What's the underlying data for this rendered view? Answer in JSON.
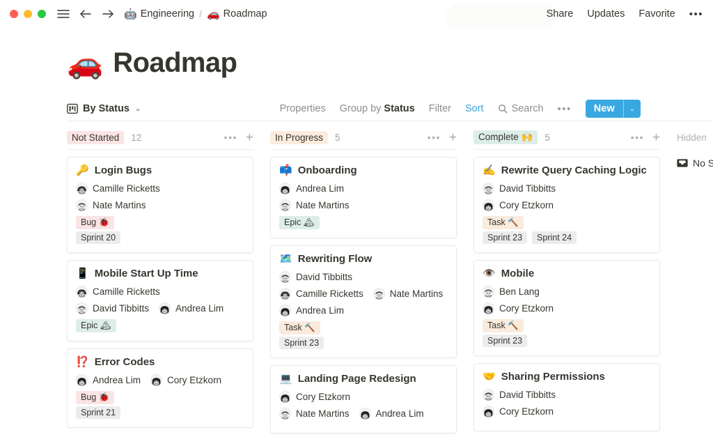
{
  "window": {
    "traffic_lights": [
      "close",
      "minimize",
      "zoom"
    ],
    "sidebar_toggle_name": "menu-icon",
    "back_label": "←",
    "forward_label": "→"
  },
  "breadcrumb": {
    "items": [
      {
        "emoji": "🤖",
        "label": "Engineering"
      },
      {
        "emoji": "🚗",
        "label": "Roadmap"
      }
    ],
    "separator": "/"
  },
  "topbar_actions": {
    "share": "Share",
    "updates": "Updates",
    "favorite": "Favorite",
    "more": "•••"
  },
  "page": {
    "emoji": "🚗",
    "title": "Roadmap"
  },
  "viewbar": {
    "view_name": "By Status",
    "view_chevron": "⌄",
    "properties": "Properties",
    "group_by_prefix": "Group by ",
    "group_by_value": "Status",
    "filter": "Filter",
    "sort": "Sort",
    "search": "Search",
    "more": "•••",
    "new_label": "New",
    "new_chevron": "⌄",
    "accent_color": "#3aa8e0",
    "sort_color": "#3da5e0"
  },
  "board": {
    "columns": [
      {
        "name": "Not Started",
        "chip_bg": "#fbe4e4",
        "count": "12",
        "more": "•••",
        "add": "+",
        "cards": [
          {
            "emoji": "🔑",
            "title": "Login Bugs",
            "people_rows": [
              [
                {
                  "name": "Camille Ricketts",
                  "avatar": "camille"
                }
              ],
              [
                {
                  "name": "Nate Martins",
                  "avatar": "nate"
                }
              ]
            ],
            "tag_rows": [
              [
                {
                  "label": "Bug 🐞",
                  "bg": "#fbe4e4"
                }
              ],
              [
                {
                  "label": "Sprint 20",
                  "bg": "#ebeced"
                }
              ]
            ]
          },
          {
            "emoji": "📱",
            "title": "Mobile Start Up Time",
            "people_rows": [
              [
                {
                  "name": "Camille Ricketts",
                  "avatar": "camille"
                }
              ],
              [
                {
                  "name": "David Tibbitts",
                  "avatar": "david"
                },
                {
                  "name": "Andrea Lim",
                  "avatar": "andrea"
                }
              ]
            ],
            "tag_rows": [
              [
                {
                  "label": "Epic 🏔",
                  "bg": "#ddedea"
                }
              ]
            ]
          },
          {
            "emoji": "⁉️",
            "title": "Error Codes",
            "people_rows": [
              [
                {
                  "name": "Andrea Lim",
                  "avatar": "andrea"
                },
                {
                  "name": "Cory Etzkorn",
                  "avatar": "cory"
                }
              ]
            ],
            "tag_rows": [
              [
                {
                  "label": "Bug 🐞",
                  "bg": "#fbe4e4"
                }
              ],
              [
                {
                  "label": "Sprint 21",
                  "bg": "#ebeced"
                }
              ]
            ]
          }
        ]
      },
      {
        "name": "In Progress",
        "chip_bg": "#fbecdd",
        "count": "5",
        "more": "•••",
        "add": "+",
        "cards": [
          {
            "emoji": "📫",
            "title": "Onboarding",
            "people_rows": [
              [
                {
                  "name": "Andrea Lim",
                  "avatar": "andrea"
                }
              ],
              [
                {
                  "name": "Nate Martins",
                  "avatar": "nate"
                }
              ]
            ],
            "tag_rows": [
              [
                {
                  "label": "Epic 🏔",
                  "bg": "#ddedea"
                }
              ]
            ]
          },
          {
            "emoji": "🗺️",
            "title": "Rewriting Flow",
            "people_rows": [
              [
                {
                  "name": "David Tibbitts",
                  "avatar": "david"
                }
              ],
              [
                {
                  "name": "Camille Ricketts",
                  "avatar": "camille"
                },
                {
                  "name": "Nate Martins",
                  "avatar": "nate"
                }
              ],
              [
                {
                  "name": "Andrea Lim",
                  "avatar": "andrea"
                }
              ]
            ],
            "tag_rows": [
              [
                {
                  "label": "Task 🔨",
                  "bg": "#faebdd"
                }
              ],
              [
                {
                  "label": "Sprint 23",
                  "bg": "#ebeced"
                }
              ]
            ]
          },
          {
            "emoji": "💻",
            "title": "Landing Page Redesign",
            "people_rows": [
              [
                {
                  "name": "Cory Etzkorn",
                  "avatar": "cory"
                }
              ],
              [
                {
                  "name": "Nate Martins",
                  "avatar": "nate"
                },
                {
                  "name": "Andrea Lim",
                  "avatar": "andrea"
                }
              ]
            ],
            "tag_rows": []
          }
        ]
      },
      {
        "name": "Complete 🙌",
        "chip_bg": "#ddedea",
        "count": "5",
        "more": "•••",
        "add": "+",
        "cards": [
          {
            "emoji": "✍️",
            "title": "Rewrite Query Caching Logic",
            "people_rows": [
              [
                {
                  "name": "David Tibbitts",
                  "avatar": "david"
                }
              ],
              [
                {
                  "name": "Cory Etzkorn",
                  "avatar": "cory"
                }
              ]
            ],
            "tag_rows": [
              [
                {
                  "label": "Task 🔨",
                  "bg": "#faebdd"
                }
              ],
              [
                {
                  "label": "Sprint 23",
                  "bg": "#ebeced"
                },
                {
                  "label": "Sprint 24",
                  "bg": "#ebeced"
                }
              ]
            ]
          },
          {
            "emoji": "👁️",
            "title": "Mobile",
            "people_rows": [
              [
                {
                  "name": "Ben Lang",
                  "avatar": "ben"
                }
              ],
              [
                {
                  "name": "Cory Etzkorn",
                  "avatar": "cory"
                }
              ]
            ],
            "tag_rows": [
              [
                {
                  "label": "Task 🔨",
                  "bg": "#faebdd"
                }
              ],
              [
                {
                  "label": "Sprint 23",
                  "bg": "#ebeced"
                }
              ]
            ]
          },
          {
            "emoji": "🤝",
            "title": "Sharing Permissions",
            "people_rows": [
              [
                {
                  "name": "David Tibbitts",
                  "avatar": "david"
                }
              ],
              [
                {
                  "name": "Cory Etzkorn",
                  "avatar": "cory"
                }
              ]
            ],
            "tag_rows": []
          }
        ]
      }
    ],
    "hidden_column": {
      "label": "Hidden",
      "item_label": "No Status",
      "icon": "inbox-icon"
    }
  }
}
